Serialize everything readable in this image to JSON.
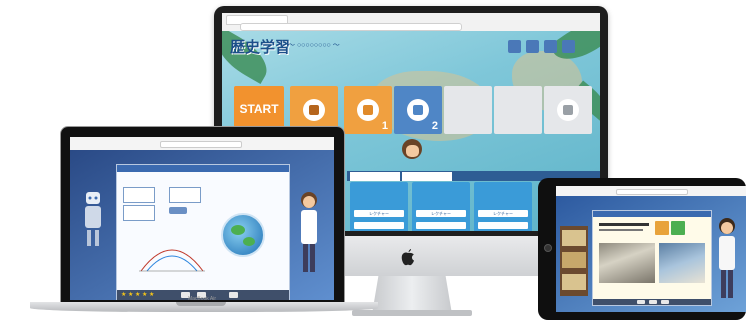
{
  "imac": {
    "app_title": "歴史学習",
    "app_subtitle": "〜 ○○○○○○○○ 〜",
    "start_label": "START",
    "tile_numbers": [
      "1",
      "2"
    ],
    "header_buttons": [
      "",
      "",
      "",
      ""
    ],
    "panel_tabs": [
      "",
      ""
    ],
    "cards": [
      {
        "title": "",
        "text": "",
        "button": "レクチャー",
        "button2": ""
      },
      {
        "title": "",
        "text": "",
        "button": "レクチャー",
        "button2": ""
      },
      {
        "title": "",
        "text": "",
        "button": "レクチャー",
        "button2": ""
      }
    ],
    "colors": {
      "start": "#f2922e",
      "accent": "#4f86c6",
      "card": "#3a9bd8"
    }
  },
  "macbook": {
    "brand": "MacBook Air",
    "rating_stars": 5
  },
  "ipad": {}
}
